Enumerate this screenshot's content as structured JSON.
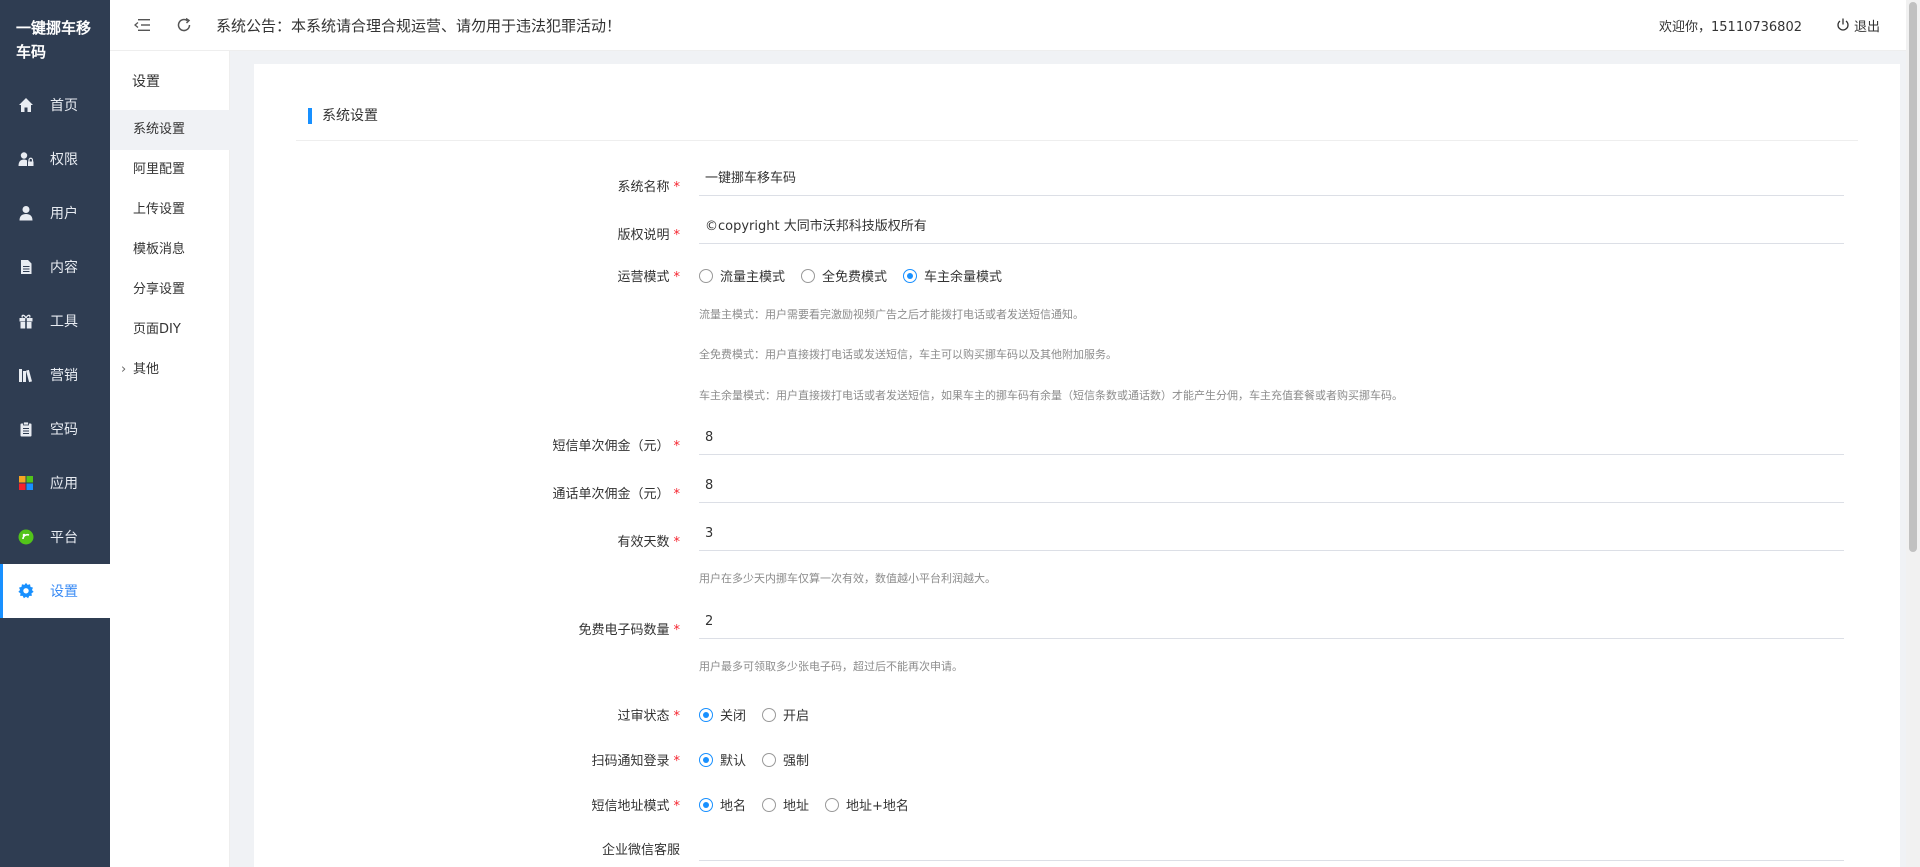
{
  "brand": "一键挪车移车码",
  "nav": [
    {
      "label": "首页",
      "icon": "home-icon"
    },
    {
      "label": "权限",
      "icon": "user-lock-icon"
    },
    {
      "label": "用户",
      "icon": "user-icon"
    },
    {
      "label": "内容",
      "icon": "document-icon"
    },
    {
      "label": "工具",
      "icon": "gift-icon"
    },
    {
      "label": "营销",
      "icon": "books-icon"
    },
    {
      "label": "空码",
      "icon": "clipboard-icon"
    },
    {
      "label": "应用",
      "icon": "apps-icon"
    },
    {
      "label": "平台",
      "icon": "platform-icon"
    },
    {
      "label": "设置",
      "icon": "gear-icon"
    }
  ],
  "submenu": {
    "title": "设置",
    "items": [
      "系统设置",
      "阿里配置",
      "上传设置",
      "模板消息",
      "分享设置",
      "页面DIY",
      "其他"
    ]
  },
  "topbar": {
    "notice": "系统公告：本系统请合理合规运营、请勿用于违法犯罪活动！",
    "welcome": "欢迎你，15110736802",
    "logout": "退出"
  },
  "form": {
    "section_title": "系统设置",
    "system_name": {
      "label": "系统名称",
      "value": "一键挪车移车码"
    },
    "copyright": {
      "label": "版权说明",
      "value": "©copyright 大同市沃邦科技版权所有"
    },
    "mode": {
      "label": "运营模式",
      "options": [
        "流量主模式",
        "全免费模式",
        "车主余量模式"
      ],
      "selected": 2,
      "hints": [
        "流量主模式：用户需要看完激励视频广告之后才能拨打电话或者发送短信通知。",
        "全免费模式：用户直接拨打电话或发送短信，车主可以购买挪车码以及其他附加服务。",
        "车主余量模式：用户直接拨打电话或者发送短信，如果车主的挪车码有余量（短信条数或通话数）才能产生分佣，车主充值套餐或者购买挪车码。"
      ]
    },
    "sms_commission": {
      "label": "短信单次佣金（元）",
      "value": "8"
    },
    "call_commission": {
      "label": "通话单次佣金（元）",
      "value": "8"
    },
    "valid_days": {
      "label": "有效天数",
      "value": "3",
      "hint": "用户在多少天内挪车仅算一次有效，数值越小平台利润越大。"
    },
    "free_codes": {
      "label": "免费电子码数量",
      "value": "2",
      "hint": "用户最多可领取多少张电子码，超过后不能再次申请。"
    },
    "review": {
      "label": "过审状态",
      "options": [
        "关闭",
        "开启"
      ],
      "selected": 0
    },
    "scan_login": {
      "label": "扫码通知登录",
      "options": [
        "默认",
        "强制"
      ],
      "selected": 0
    },
    "sms_address": {
      "label": "短信地址模式",
      "options": [
        "地名",
        "地址",
        "地址+地名"
      ],
      "selected": 0
    },
    "wecom": {
      "label": "企业微信客服",
      "value": ""
    }
  },
  "colors": {
    "sidebar": "#2f3d52",
    "accent": "#1890ff",
    "required": "#f5222d"
  }
}
